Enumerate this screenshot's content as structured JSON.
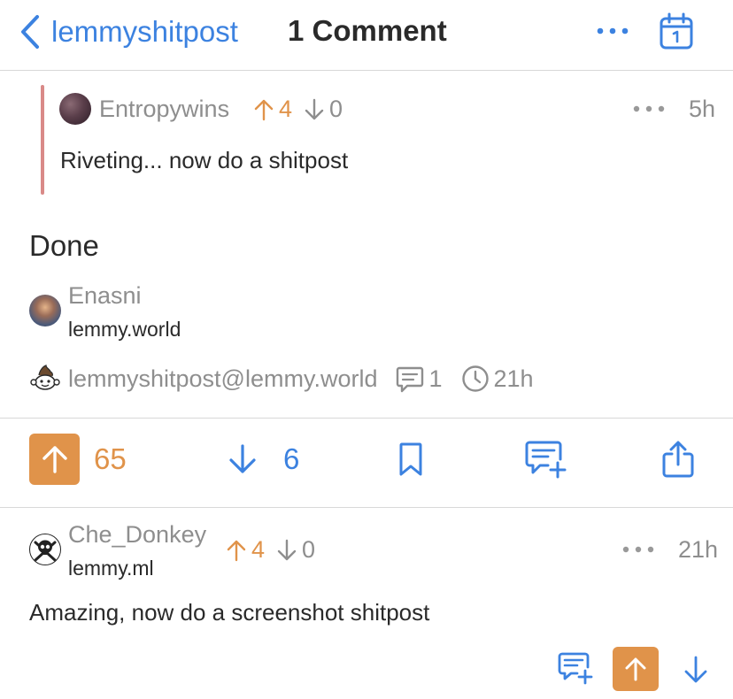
{
  "colors": {
    "accent_blue": "#3c82e0",
    "vote_orange": "#e0934a",
    "muted_gray": "#8e8e8e",
    "quote_bar": "#d98a88"
  },
  "header": {
    "back_label": "lemmyshitpost",
    "title": "1 Comment",
    "icons": [
      "chevron-left-icon",
      "more-horizontal-icon",
      "calendar-icon"
    ]
  },
  "parent_comment": {
    "author": "Entropywins",
    "upvotes": "4",
    "downvotes": "0",
    "time": "5h",
    "text": "Riveting... now do a shitpost"
  },
  "post": {
    "body": "Done",
    "author": "Enasni",
    "instance": "lemmy.world",
    "community": "lemmyshitpost@lemmy.world",
    "comment_count": "1",
    "age": "21h"
  },
  "actions": {
    "upvotes": "65",
    "downvotes": "6",
    "upvoted": true,
    "icons": [
      "arrow-up-icon",
      "arrow-down-icon",
      "bookmark-icon",
      "reply-icon",
      "share-icon"
    ]
  },
  "comment": {
    "author": "Che_Donkey",
    "instance": "lemmy.ml",
    "upvotes": "4",
    "downvotes": "0",
    "time": "21h",
    "text": "Amazing, now do a screenshot shitpost",
    "upvoted": true
  }
}
